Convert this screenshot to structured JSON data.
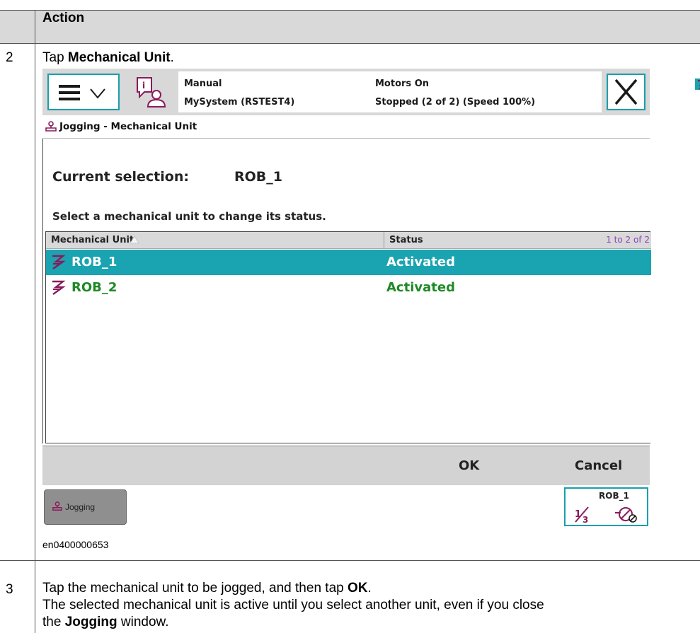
{
  "doc": {
    "header": "Action",
    "step2": {
      "number": "2",
      "prefix": "Tap ",
      "bold": "Mechanical Unit",
      "suffix": "."
    },
    "caption": "en0400000653",
    "step3": {
      "number": "3",
      "line1_prefix": "Tap the mechanical unit to be jogged, and then tap ",
      "line1_bold": "OK",
      "line1_suffix": ".",
      "line2": "The selected mechanical unit is active until you select another unit, even if you close",
      "line3_prefix": "the ",
      "line3_bold": "Jogging",
      "line3_suffix": " window."
    }
  },
  "pendant": {
    "status": {
      "mode": "Manual",
      "system": "MySystem (RSTEST4)",
      "motors": "Motors On",
      "state": "Stopped (2 of 2) (Speed 100%)"
    },
    "window_title": "Jogging - Mechanical Unit",
    "current_selection_label": "Current selection:",
    "current_selection_value": "ROB_1",
    "instruction": "Select a mechanical unit to change its status.",
    "table": {
      "columns": [
        "Mechanical Unit",
        "Status"
      ],
      "count": "1 to 2 of 2",
      "rows": [
        {
          "name": "ROB_1",
          "status": "Activated",
          "selected": true
        },
        {
          "name": "ROB_2",
          "status": "Activated",
          "selected": false
        }
      ]
    },
    "commands": {
      "ok": "OK",
      "cancel": "Cancel"
    },
    "taskbar": {
      "jogging": "Jogging",
      "quickset_unit": "ROB_1"
    },
    "colors": {
      "accent": "#1aa3b0",
      "active_text": "#1e8a25",
      "icon_purple": "#8a1b5c"
    }
  }
}
